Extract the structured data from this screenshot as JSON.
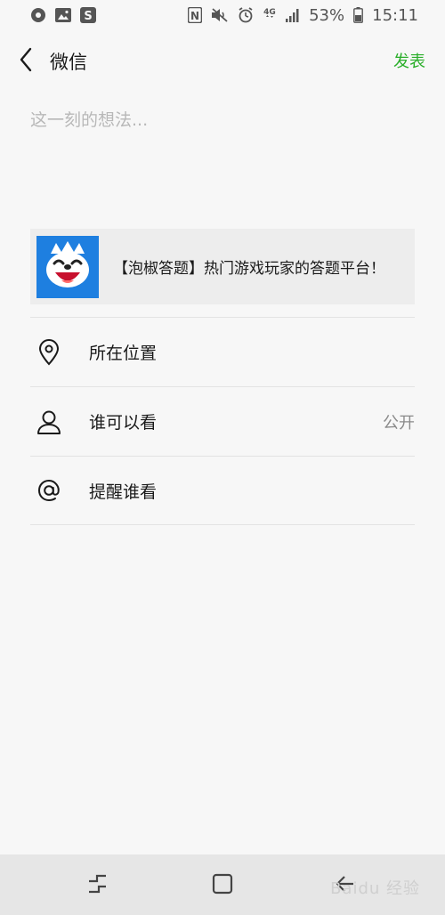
{
  "status_bar": {
    "battery": "53%",
    "time": "15:11",
    "network": "4G",
    "left_icons": [
      "location-sync-icon",
      "gallery-icon",
      "sogou-icon"
    ],
    "right_icons": [
      "nfc-icon",
      "mute-icon",
      "alarm-icon",
      "4g-icon",
      "signal-icon",
      "battery-icon"
    ]
  },
  "header": {
    "title": "微信",
    "publish_label": "发表",
    "accent_color": "#2aae2a"
  },
  "composer": {
    "placeholder": "这一刻的想法..."
  },
  "link_card": {
    "title": "【泡椒答题】热门游戏玩家的答题平台！",
    "thumbnail_color": "#1e7fe0"
  },
  "options": [
    {
      "icon": "location-pin-icon",
      "label": "所在位置",
      "value": ""
    },
    {
      "icon": "person-icon",
      "label": "谁可以看",
      "value": "公开"
    },
    {
      "icon": "at-icon",
      "label": "提醒谁看",
      "value": ""
    }
  ],
  "watermark": {
    "text": "Baidu 经验"
  }
}
